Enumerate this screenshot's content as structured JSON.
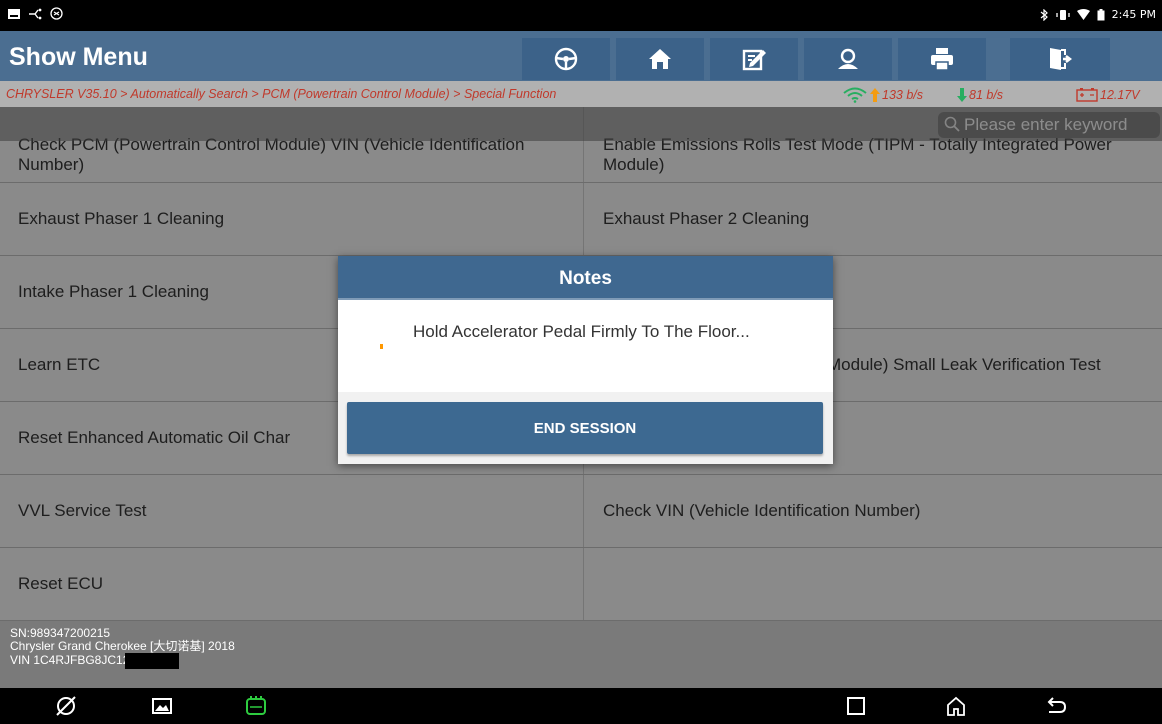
{
  "status": {
    "time": "2:45 PM"
  },
  "header": {
    "title": "Show Menu",
    "tools": [
      "steering-wheel-icon",
      "home-icon",
      "edit-icon",
      "user-icon",
      "print-icon",
      "exit-icon"
    ]
  },
  "breadcrumb": {
    "path": "CHRYSLER V35.10 > Automatically Search > PCM (Powertrain Control Module) > Special Function",
    "upload": "133 b/s",
    "download": "81 b/s",
    "voltage": "12.17V"
  },
  "search": {
    "placeholder": "Please enter keyword"
  },
  "menu": {
    "rows": [
      {
        "left": "Check PCM (Powertrain Control Module) VIN (Vehicle Identification Number)",
        "right": "Enable Emissions Rolls Test Mode (TIPM - Totally Integrated Power Module)"
      },
      {
        "left": "Exhaust Phaser 1 Cleaning",
        "right": "Exhaust Phaser 2 Cleaning"
      },
      {
        "left": "Intake Phaser 1 Cleaning",
        "right": ""
      },
      {
        "left": "Learn ETC",
        "right": "Module) Small Leak Verification Test"
      },
      {
        "left": "Reset Enhanced Automatic Oil Char",
        "right": ""
      },
      {
        "left": "VVL Service Test",
        "right": "Check VIN (Vehicle Identification Number)"
      },
      {
        "left": "Reset ECU",
        "right": ""
      }
    ]
  },
  "footer": {
    "sn": "SN:989347200215",
    "vehicle": "Chrysler Grand Cherokee [大切诺基] 2018",
    "vin": "VIN 1C4RJFBG8JC12"
  },
  "dialog": {
    "title": "Notes",
    "message": "Hold Accelerator Pedal Firmly To The Floor...",
    "button": "END SESSION"
  },
  "colors": {
    "header": "#4b6e91",
    "accent_red": "#c0392b",
    "bullet": "#ff9800"
  }
}
